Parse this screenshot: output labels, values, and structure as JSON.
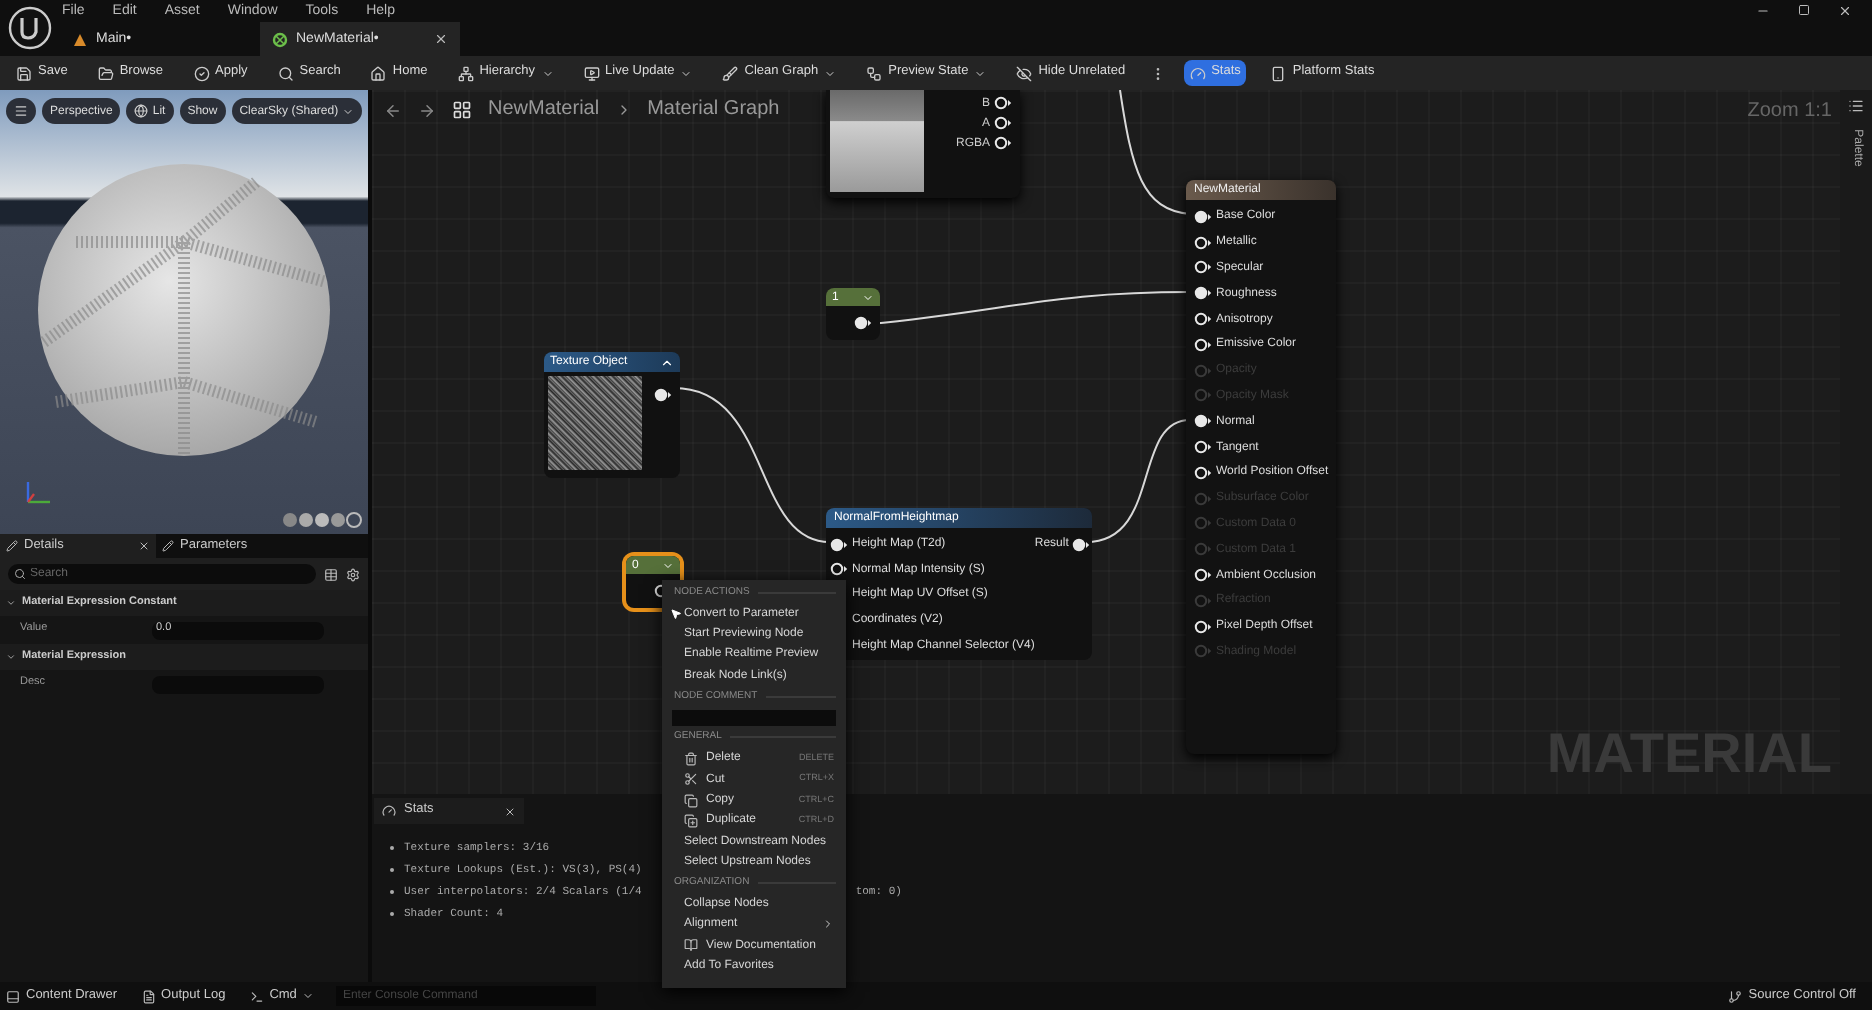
{
  "menu_bar": {
    "items": [
      "File",
      "Edit",
      "Asset",
      "Window",
      "Tools",
      "Help"
    ]
  },
  "document_tabs": [
    {
      "label": "Main•",
      "selected": false
    },
    {
      "label": "NewMaterial•",
      "selected": true
    }
  ],
  "toolbar": [
    {
      "kind": "save",
      "label": "Save",
      "dropdown": false,
      "selected": false
    },
    {
      "kind": "browse",
      "label": "Browse",
      "dropdown": false,
      "selected": false
    },
    {
      "kind": "apply",
      "label": "Apply",
      "dropdown": false,
      "selected": false
    },
    {
      "kind": "search",
      "label": "Search",
      "dropdown": false,
      "selected": false
    },
    {
      "kind": "home",
      "label": "Home",
      "dropdown": false,
      "selected": false
    },
    {
      "kind": "hierarchy",
      "label": "Hierarchy",
      "dropdown": true,
      "selected": false
    },
    {
      "kind": "live",
      "label": "Live Update",
      "dropdown": true,
      "selected": false
    },
    {
      "kind": "clean",
      "label": "Clean Graph",
      "dropdown": true,
      "selected": false
    },
    {
      "kind": "preview",
      "label": "Preview State",
      "dropdown": true,
      "selected": false
    },
    {
      "kind": "hide",
      "label": "Hide Unrelated",
      "dropdown": false,
      "selected": false
    },
    {
      "kind": "more"
    },
    {
      "kind": "stats",
      "label": "Stats",
      "dropdown": false,
      "selected": true
    },
    {
      "kind": "platform",
      "label": "Platform Stats",
      "dropdown": false,
      "selected": false
    }
  ],
  "viewport": {
    "buttons": [
      {
        "kind": "menu"
      },
      {
        "kind": "text",
        "label": "Perspective"
      },
      {
        "kind": "lit",
        "label": "Lit"
      },
      {
        "kind": "text",
        "label": "Show"
      },
      {
        "kind": "dropdown",
        "label": "ClearSky (Shared)"
      }
    ]
  },
  "details": {
    "tabs": [
      {
        "label": "Details",
        "selected": true
      },
      {
        "label": "Parameters",
        "selected": false
      }
    ],
    "search": {
      "placeholder": "Search"
    },
    "sections": [
      {
        "title": "Material Expression Constant",
        "expanded": true,
        "rows": [
          {
            "label": "Value",
            "value": "0.0"
          }
        ]
      },
      {
        "title": "Material Expression",
        "expanded": true,
        "rows": [
          {
            "label": "Desc"
          }
        ]
      }
    ]
  },
  "graph": {
    "breadcrumb": [
      "NewMaterial",
      "Material Graph"
    ],
    "zoom": "Zoom 1:1",
    "graph_type": "MATERIAL",
    "palette": "Palette",
    "nodes": [
      {
        "kind": "texture_sample",
        "pins": [
          {
            "label": "B",
            "connected": false
          },
          {
            "label": "A",
            "connected": false
          },
          {
            "label": "RGBA",
            "connected": false
          }
        ]
      },
      {
        "kind": "constant",
        "value": "1",
        "selected": false
      },
      {
        "kind": "texture_object",
        "title": "Texture Object",
        "expanded": true
      },
      {
        "kind": "constant",
        "value": "0",
        "selected": true
      },
      {
        "kind": "function",
        "title": "NormalFromHeightmap",
        "output": "Result",
        "inputs": [
          {
            "label": "Height Map (T2d)",
            "connected": true
          },
          {
            "label": "Normal Map Intensity (S)",
            "connected": false
          },
          {
            "label": "Height Map UV Offset (S)"
          },
          {
            "label": "Coordinates (V2)"
          },
          {
            "label": "Height Map Channel Selector (V4)"
          }
        ]
      },
      {
        "kind": "material_output",
        "title": "NewMaterial",
        "pins": [
          {
            "label": "Base Color",
            "connected": true,
            "disabled": false
          },
          {
            "label": "Metallic",
            "connected": false,
            "disabled": false
          },
          {
            "label": "Specular",
            "connected": false,
            "disabled": false
          },
          {
            "label": "Roughness",
            "connected": true,
            "disabled": false
          },
          {
            "label": "Anisotropy",
            "connected": false,
            "disabled": false
          },
          {
            "label": "Emissive Color",
            "connected": false,
            "disabled": false
          },
          {
            "label": "Opacity",
            "connected": false,
            "disabled": true
          },
          {
            "label": "Opacity Mask",
            "connected": false,
            "disabled": true
          },
          {
            "label": "Normal",
            "connected": true,
            "disabled": false
          },
          {
            "label": "Tangent",
            "connected": false,
            "disabled": false
          },
          {
            "label": "World Position Offset",
            "connected": false,
            "disabled": false
          },
          {
            "label": "Subsurface Color",
            "connected": false,
            "disabled": true
          },
          {
            "label": "Custom Data 0",
            "connected": false,
            "disabled": true
          },
          {
            "label": "Custom Data 1",
            "connected": false,
            "disabled": true
          },
          {
            "label": "Ambient Occlusion",
            "connected": false,
            "disabled": false
          },
          {
            "label": "Refraction",
            "connected": false,
            "disabled": true
          },
          {
            "label": "Pixel Depth Offset",
            "connected": false,
            "disabled": false
          },
          {
            "label": "Shading Model",
            "connected": false,
            "disabled": true
          }
        ]
      }
    ]
  },
  "context_menu": {
    "sections": [
      {
        "kind": "items",
        "heading": "NODE ACTIONS",
        "items": [
          {
            "kind": "plain",
            "label": "Convert to Parameter",
            "hovered": true
          },
          {
            "kind": "plain",
            "label": "Start Previewing Node"
          },
          {
            "kind": "plain",
            "label": "Enable Realtime Preview"
          },
          {
            "kind": "plain",
            "label": "Break Node Link(s)"
          }
        ]
      },
      {
        "kind": "comment",
        "heading": "NODE COMMENT"
      },
      {
        "kind": "items",
        "heading": "GENERAL",
        "items": [
          {
            "kind": "delete",
            "label": "Delete",
            "shortcut": "DELETE"
          },
          {
            "kind": "cut",
            "label": "Cut",
            "shortcut": "CTRL+X"
          },
          {
            "kind": "copy",
            "label": "Copy",
            "shortcut": "CTRL+C"
          },
          {
            "kind": "duplicate",
            "label": "Duplicate",
            "shortcut": "CTRL+D"
          },
          {
            "kind": "plain",
            "label": "Select Downstream Nodes"
          },
          {
            "kind": "plain",
            "label": "Select Upstream Nodes"
          }
        ]
      },
      {
        "kind": "items",
        "heading": "ORGANIZATION",
        "items": [
          {
            "kind": "plain",
            "label": "Collapse Nodes"
          },
          {
            "kind": "submenu",
            "label": "Alignment"
          },
          {
            "kind": "docs",
            "label": "View Documentation"
          },
          {
            "kind": "plain",
            "label": "Add To Favorites"
          }
        ]
      }
    ]
  },
  "stats": {
    "title": "Stats",
    "lines": [
      {
        "text": "Texture samplers: 3/16"
      },
      {
        "text": "Texture Lookups (Est.): VS(3), PS(4)"
      },
      {
        "text": "User interpolators: 2/4 Scalars (1/4",
        "tail": "tom: 0)"
      },
      {
        "text": "Shader Count: 4"
      }
    ]
  },
  "status_bar": {
    "items": [
      {
        "kind": "drawer",
        "label": "Content Drawer"
      },
      {
        "kind": "log",
        "label": "Output Log"
      },
      {
        "kind": "cmd",
        "label": "Cmd"
      }
    ],
    "console": {
      "placeholder": "Enter Console Command"
    },
    "source_control": "Source Control Off"
  }
}
